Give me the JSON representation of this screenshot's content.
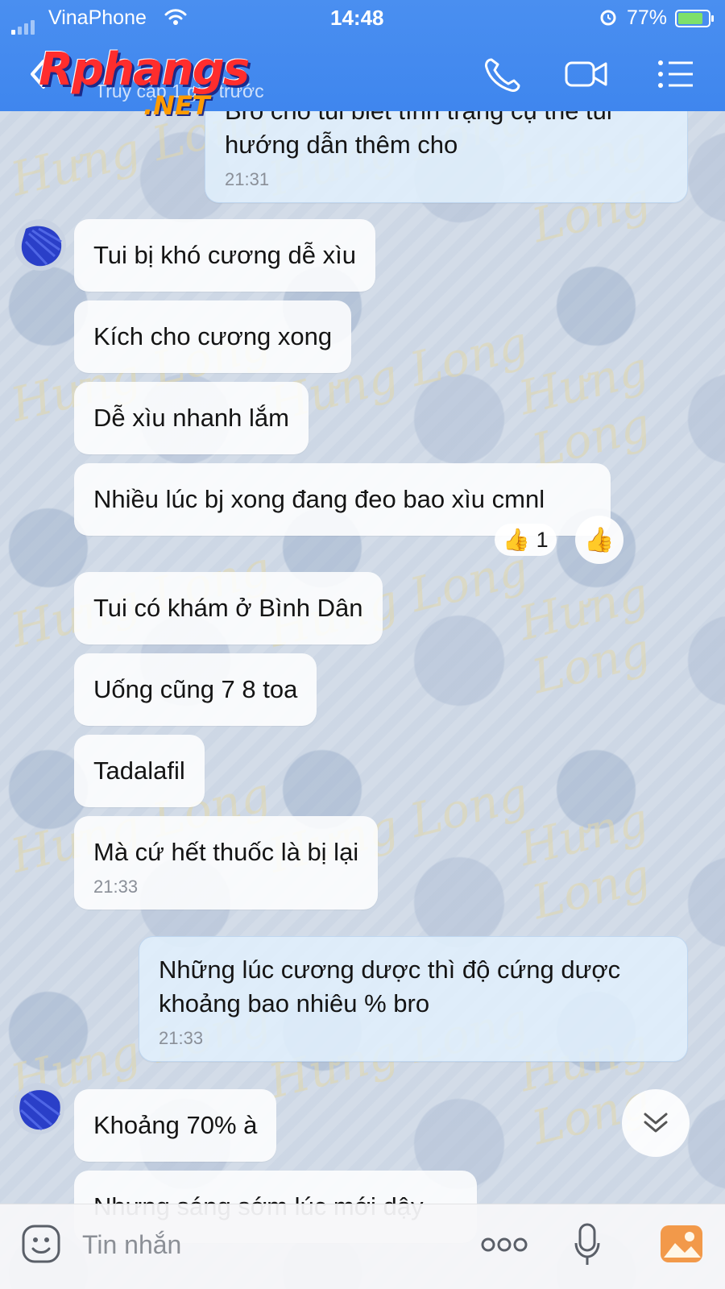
{
  "status_bar": {
    "carrier": "VinaPhone",
    "time": "14:48",
    "battery": "77%",
    "battery_level": 0.77
  },
  "header": {
    "logo_text": "Rphangs",
    "logo_suffix": ".NET",
    "subtitle": "Truy cập 1 giờ trước",
    "icons": [
      "back-icon",
      "phone-icon",
      "video-call-icon",
      "menu-icon"
    ]
  },
  "watermark": "Hưng Long",
  "messages": [
    {
      "sender": "me",
      "lines": [
        "Bro cho tui biết tình trạng cụ thể tui",
        "hướng dẫn thêm cho"
      ],
      "time": "21:31"
    },
    {
      "sender": "other",
      "text": "Tui bị khó cương dễ xìu"
    },
    {
      "sender": "other",
      "text": "Kích cho cương xong"
    },
    {
      "sender": "other",
      "text": "Dễ xìu nhanh lắm"
    },
    {
      "sender": "other",
      "text": "Nhiều lúc bj xong đang đeo bao xìu cmnl",
      "reaction": {
        "emoji": "👍",
        "count": "1"
      }
    },
    {
      "sender": "other",
      "text": "Tui có khám ở Bình Dân"
    },
    {
      "sender": "other",
      "text": "Uống cũng 7 8 toa"
    },
    {
      "sender": "other",
      "text": "Tadalafil"
    },
    {
      "sender": "other",
      "text": "Mà cứ hết thuốc là bị lại",
      "time": "21:33"
    },
    {
      "sender": "me",
      "lines": [
        "Những lúc cương dược thì độ cứng dược",
        "khoảng bao nhiêu % bro"
      ],
      "time": "21:33"
    },
    {
      "sender": "other",
      "text": "Khoảng 70% à"
    },
    {
      "sender": "other",
      "text": "Nhưng sáng sớm lúc mới dậy"
    }
  ],
  "composer": {
    "placeholder": "Tin nhắn",
    "icons": [
      "emoji-icon",
      "more-icon",
      "microphone-icon",
      "image-icon"
    ]
  }
}
